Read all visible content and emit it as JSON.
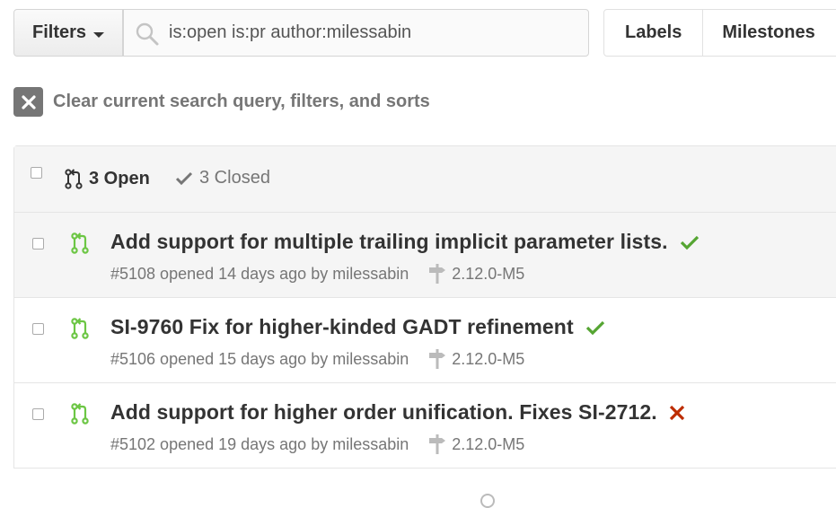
{
  "toolbar": {
    "filters_label": "Filters",
    "search_value": "is:open is:pr author:milessabin",
    "labels_label": "Labels",
    "milestones_label": "Milestones"
  },
  "clear": {
    "text": "Clear current search query, filters, and sorts"
  },
  "states": {
    "open_label": "3 Open",
    "closed_label": "3 Closed"
  },
  "pull_requests": [
    {
      "title": "Add support for multiple trailing implicit parameter lists.",
      "meta": "#5108 opened 14 days ago by milessabin",
      "milestone": "2.12.0-M5",
      "status": "success",
      "highlighted": true
    },
    {
      "title": "SI-9760 Fix for higher-kinded GADT refinement",
      "meta": "#5106 opened 15 days ago by milessabin",
      "milestone": "2.12.0-M5",
      "status": "success",
      "highlighted": false
    },
    {
      "title": "Add support for higher order unification. Fixes SI-2712.",
      "meta": "#5102 opened 19 days ago by milessabin",
      "milestone": "2.12.0-M5",
      "status": "failure",
      "highlighted": false
    }
  ],
  "colors": {
    "open_pr_icon": "#6cc644",
    "success": "#55a532",
    "failure": "#bd2c00",
    "muted": "#767676"
  }
}
